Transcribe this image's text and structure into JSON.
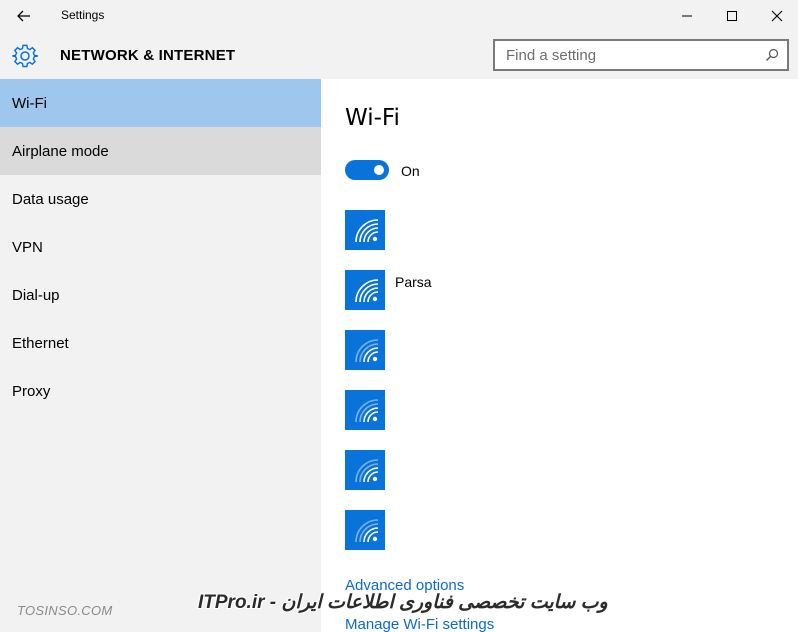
{
  "window": {
    "title": "Settings",
    "back_icon": "back-arrow-icon",
    "minimize_icon": "minimize-icon",
    "maximize_icon": "maximize-icon",
    "close_icon": "close-icon"
  },
  "header": {
    "icon": "gear-icon",
    "section_title": "NETWORK & INTERNET",
    "search": {
      "placeholder": "Find a setting",
      "icon": "search-icon"
    }
  },
  "sidebar": {
    "items": [
      {
        "label": "Wi-Fi",
        "state": "selected"
      },
      {
        "label": "Airplane mode",
        "state": "hover"
      },
      {
        "label": "Data usage",
        "state": "normal"
      },
      {
        "label": "VPN",
        "state": "normal"
      },
      {
        "label": "Dial-up",
        "state": "normal"
      },
      {
        "label": "Ethernet",
        "state": "normal"
      },
      {
        "label": "Proxy",
        "state": "normal"
      }
    ]
  },
  "main": {
    "title": "Wi-Fi",
    "toggle": {
      "state": "On",
      "label": "On"
    },
    "networks": [
      {
        "name": "",
        "icon": "wifi-signal-icon"
      },
      {
        "name": "Parsa",
        "icon": "wifi-signal-icon"
      },
      {
        "name": "",
        "icon": "wifi-signal-icon"
      },
      {
        "name": "",
        "icon": "wifi-signal-icon"
      },
      {
        "name": "",
        "icon": "wifi-signal-icon"
      },
      {
        "name": "",
        "icon": "wifi-signal-icon"
      }
    ],
    "links": {
      "advanced": "Advanced options",
      "manage": "Manage Wi-Fi settings"
    }
  },
  "watermarks": {
    "left": "TOSINSO.COM",
    "right": "ITPro.ir - وب سایت تخصصی فناوری اطلاعات ایران"
  },
  "colors": {
    "accent": "#0a73d9",
    "selected_nav": "#9fc6ec",
    "hover_nav": "#dadada",
    "chrome": "#f2f2f2",
    "link": "#0a6ad0"
  }
}
